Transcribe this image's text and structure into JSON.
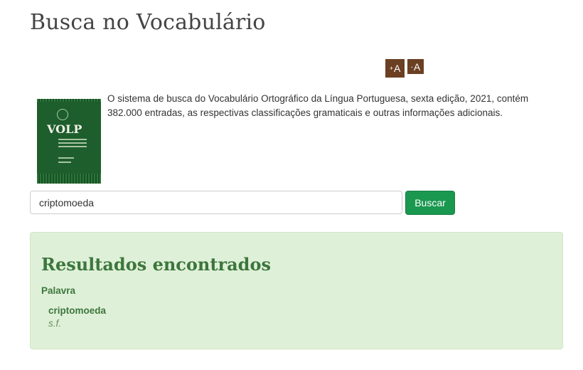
{
  "page": {
    "title": "Busca no Vocabulário"
  },
  "font_controls": {
    "increase_label": "A",
    "increase_sign": "+",
    "decrease_label": "A",
    "decrease_sign": "-"
  },
  "book_cover": {
    "logo_text": "VOLP",
    "color": "#1d5e2c"
  },
  "description": "O sistema de busca do Vocabulário Ortográfico da Língua Portuguesa, sexta edição, 2021, contém 382.000 entradas, as respectivas classificações gramaticais e outras informações adicionais.",
  "search": {
    "value": "criptomoeda",
    "placeholder": "",
    "button_label": "Buscar"
  },
  "results": {
    "title": "Resultados encontrados",
    "column_label": "Palavra",
    "items": [
      {
        "word": "criptomoeda",
        "class": "s.f."
      }
    ]
  },
  "colors": {
    "brand_brown": "#6b3f22",
    "button_green": "#1a9850",
    "panel_bg": "#dff0d8",
    "panel_text": "#3c763d"
  }
}
